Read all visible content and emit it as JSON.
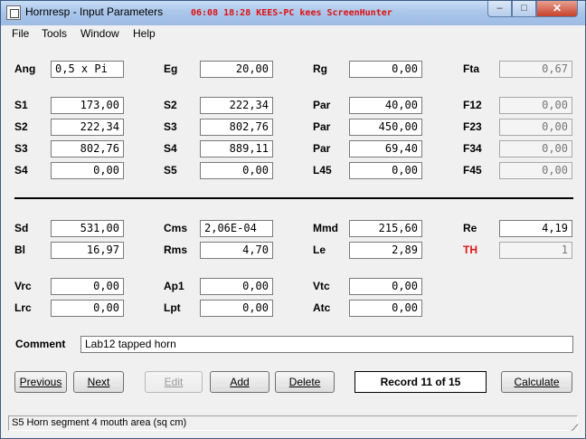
{
  "window": {
    "title": "Hornresp - Input Parameters",
    "overlay_text": "06:08  18:28  KEES-PC  kees  ScreenHunter",
    "minimize_glyph": "–",
    "maximize_glyph": "□",
    "close_glyph": "✕"
  },
  "menu": [
    "File",
    "Tools",
    "Window",
    "Help"
  ],
  "params": {
    "Ang": "0,5 x Pi",
    "Eg": "20,00",
    "Rg": "0,00",
    "Fta": "0,67",
    "S1": "173,00",
    "S2a": "222,34",
    "Par1": "40,00",
    "F12": "0,00",
    "S2": "222,34",
    "S3a": "802,76",
    "Par2": "450,00",
    "F23": "0,00",
    "S3": "802,76",
    "S4a": "889,11",
    "Par3": "69,40",
    "F34": "0,00",
    "S4": "0,00",
    "S5": "0,00",
    "L45": "0,00",
    "F45": "0,00",
    "Sd": "531,00",
    "Cms": "2,06E-04",
    "Mmd": "215,60",
    "Re": "4,19",
    "Bl": "16,97",
    "Rms": "4,70",
    "Le": "2,89",
    "TH": "1",
    "Vrc": "0,00",
    "Ap1": "0,00",
    "Vtc": "0,00",
    "Lrc": "0,00",
    "Lpt": "0,00",
    "Atc": "0,00"
  },
  "labels": {
    "Ang": "Ang",
    "Eg": "Eg",
    "Rg": "Rg",
    "Fta": "Fta",
    "S1": "S1",
    "S2": "S2",
    "Par": "Par",
    "F12": "F12",
    "S3": "S3",
    "F23": "F23",
    "S4": "S4",
    "F34": "F34",
    "S5": "S5",
    "L45": "L45",
    "F45": "F45",
    "Sd": "Sd",
    "Cms": "Cms",
    "Mmd": "Mmd",
    "Re": "Re",
    "Bl": "Bl",
    "Rms": "Rms",
    "Le": "Le",
    "TH": "TH",
    "Vrc": "Vrc",
    "Ap1": "Ap1",
    "Vtc": "Vtc",
    "Lrc": "Lrc",
    "Lpt": "Lpt",
    "Atc": "Atc"
  },
  "comment": {
    "label": "Comment",
    "value": "Lab12 tapped horn"
  },
  "buttons": {
    "previous": "Previous",
    "next": "Next",
    "edit": "Edit",
    "add": "Add",
    "delete": "Delete",
    "calculate": "Calculate"
  },
  "record": "Record 11 of 15",
  "status": "S5   Horn segment 4 mouth area  (sq cm)",
  "colors": {
    "titlebar": "#aac6ea",
    "th_label": "#e01818",
    "overlay": "#e01010"
  }
}
